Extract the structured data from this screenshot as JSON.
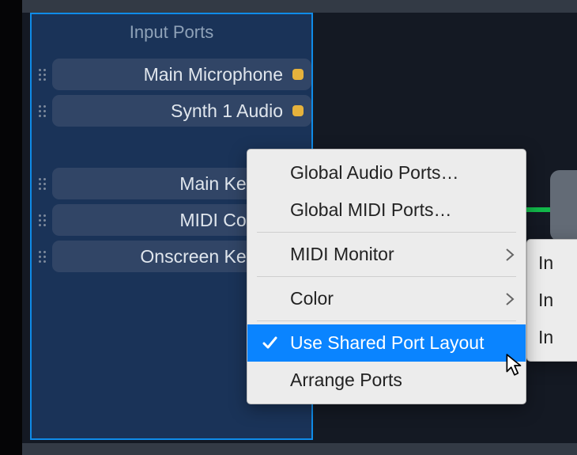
{
  "panel": {
    "title": "Input Ports",
    "audio_ports": [
      {
        "label": "Main Microphone"
      },
      {
        "label": "Synth 1 Audio"
      }
    ],
    "midi_ports": [
      {
        "label": "Main Keyboard"
      },
      {
        "label": "MIDI Controller"
      },
      {
        "label": "Onscreen Keyboard"
      }
    ]
  },
  "context_menu": {
    "global_audio": "Global Audio Ports…",
    "global_midi": "Global MIDI Ports…",
    "midi_monitor": "MIDI Monitor",
    "color": "Color",
    "shared_layout": "Use Shared Port Layout",
    "arrange": "Arrange Ports"
  },
  "submenu": {
    "item0": "In",
    "item1": "In",
    "item2": "In"
  }
}
